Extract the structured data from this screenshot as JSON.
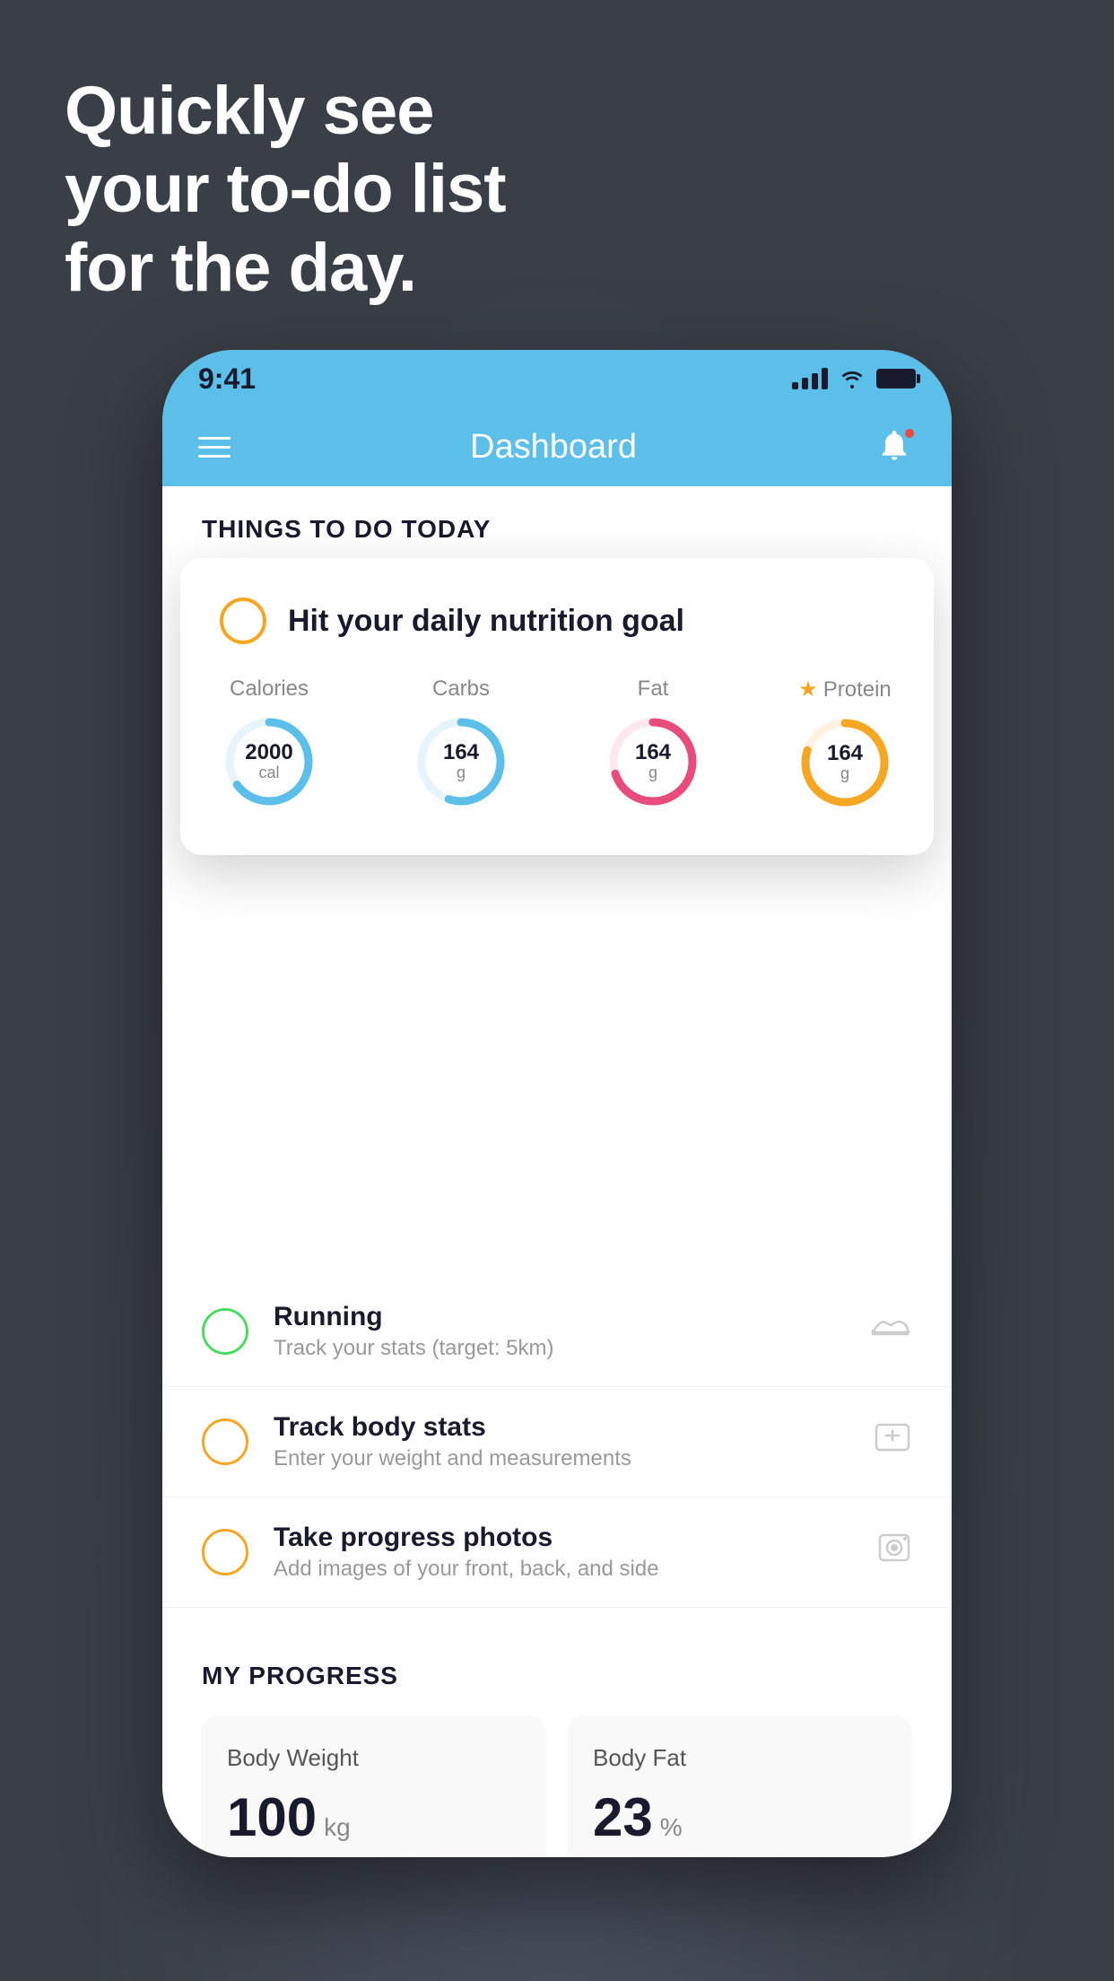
{
  "background": "#3a3f47",
  "headline": {
    "line1": "Quickly see",
    "line2": "your to-do list",
    "line3": "for the day."
  },
  "statusBar": {
    "time": "9:41",
    "accentColor": "#5bbfea"
  },
  "appHeader": {
    "title": "Dashboard",
    "menuIcon": "hamburger-icon",
    "notificationIcon": "bell-icon"
  },
  "floatingCard": {
    "circleColor": "#f5a623",
    "title": "Hit your daily nutrition goal",
    "nutritionItems": [
      {
        "label": "Calories",
        "value": "2000",
        "unit": "cal",
        "color": "#5bbfea",
        "progress": 0.65,
        "starred": false
      },
      {
        "label": "Carbs",
        "value": "164",
        "unit": "g",
        "color": "#5bbfea",
        "progress": 0.55,
        "starred": false
      },
      {
        "label": "Fat",
        "value": "164",
        "unit": "g",
        "color": "#e74c7c",
        "progress": 0.7,
        "starred": false
      },
      {
        "label": "Protein",
        "value": "164",
        "unit": "g",
        "color": "#f5a623",
        "progress": 0.8,
        "starred": true
      }
    ]
  },
  "sectionTitle": "THINGS TO DO TODAY",
  "todoItems": [
    {
      "id": "nutrition",
      "title": "Hit your daily nutrition goal",
      "subtitle": "",
      "circleColor": "#f5a623",
      "icon": "nutrition-icon",
      "iconSymbol": "●"
    },
    {
      "id": "running",
      "title": "Running",
      "subtitle": "Track your stats (target: 5km)",
      "circleColor": "#4cd964",
      "icon": "shoe-icon",
      "iconSymbol": "👟"
    },
    {
      "id": "body-stats",
      "title": "Track body stats",
      "subtitle": "Enter your weight and measurements",
      "circleColor": "#f5a623",
      "icon": "scale-icon",
      "iconSymbol": "⊡"
    },
    {
      "id": "progress-photos",
      "title": "Take progress photos",
      "subtitle": "Add images of your front, back, and side",
      "circleColor": "#f5a623",
      "icon": "photo-icon",
      "iconSymbol": "👤"
    }
  ],
  "progressSection": {
    "title": "MY PROGRESS",
    "cards": [
      {
        "title": "Body Weight",
        "value": "100",
        "unit": "kg",
        "chartColor": "#5bbfea"
      },
      {
        "title": "Body Fat",
        "value": "23",
        "unit": "%",
        "chartColor": "#5bbfea"
      }
    ]
  }
}
